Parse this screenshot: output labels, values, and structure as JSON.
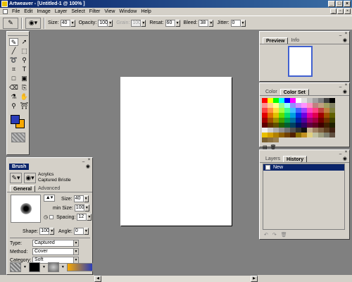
{
  "window": {
    "title": "Artweaver - [Untitled-1 @ 100% ]"
  },
  "menu": [
    "File",
    "Edit",
    "Image",
    "Layer",
    "Select",
    "Filter",
    "View",
    "Window",
    "Help"
  ],
  "options": {
    "size_label": "Size:",
    "size_value": "40",
    "opacity_label": "Opacity:",
    "opacity_value": "100",
    "grain_label": "Grain:",
    "grain_value": "100",
    "resat_label": "Resat:",
    "resat_value": "60",
    "bleed_label": "Bleed:",
    "bleed_value": "38",
    "jitter_label": "Jitter:",
    "jitter_value": "0"
  },
  "toolbox": {
    "tools": [
      "brush-icon",
      "move-arrow-icon",
      "line-icon",
      "rect-select-icon",
      "lasso-icon",
      "magic-wand-icon",
      "crop-icon",
      "text-icon",
      "rectangle-icon",
      "fill-icon",
      "eraser-icon",
      "clone-icon",
      "eyedropper-icon",
      "hand-icon",
      "zoom-icon",
      "gradient-icon"
    ],
    "foreground_color": "#2a3cb8",
    "background_color": "#f7a800"
  },
  "brush_panel": {
    "title": "Brush",
    "category_name": "Acrylics",
    "variant_name": "Captured Bristle",
    "tabs": [
      "General",
      "Advanced"
    ],
    "size_label": "Size:",
    "size_value": "40",
    "min_size_label": "min Size:",
    "min_size_value": "100",
    "spacing_label": "Spacing:",
    "spacing_value": "12",
    "shape_label": "Shape:",
    "shape_value": "100",
    "angle_label": "Angle:",
    "angle_value": "0",
    "type_label": "Type:",
    "type_value": "Captured",
    "method_label": "Method:",
    "method_value": "Cover",
    "category_label": "Category:",
    "category_value": "Soft"
  },
  "preview_panel": {
    "tabs": [
      "Preview",
      "Info"
    ]
  },
  "color_panel": {
    "tabs": [
      "Color",
      "Color Set"
    ],
    "swatches": [
      "#ff0000",
      "#ffff00",
      "#00ff00",
      "#00ffff",
      "#0000ff",
      "#ff00ff",
      "#ffffff",
      "#e0e0e0",
      "#c0c0c0",
      "#a0a0a0",
      "#808080",
      "#404040",
      "#000000",
      "#ff9090",
      "#ffd090",
      "#ffff90",
      "#90ff90",
      "#90ffff",
      "#9090ff",
      "#d090ff",
      "#ff90ff",
      "#ff90c0",
      "#c08080",
      "#c0a080",
      "#a0a060",
      "#808060",
      "#ff4040",
      "#ff9040",
      "#ffe040",
      "#a0ff40",
      "#40ff90",
      "#40c0ff",
      "#4060ff",
      "#a040ff",
      "#ff40c0",
      "#ff4080",
      "#c04040",
      "#c08040",
      "#808040",
      "#e00000",
      "#e07000",
      "#e0c000",
      "#60e000",
      "#00e070",
      "#00a0e0",
      "#0030e0",
      "#7000e0",
      "#e000a0",
      "#e00050",
      "#a00000",
      "#a05000",
      "#606000",
      "#a00000",
      "#a05000",
      "#a09000",
      "#40a000",
      "#00a050",
      "#0070a0",
      "#0020a0",
      "#5000a0",
      "#a00070",
      "#a00040",
      "#700000",
      "#703000",
      "#404000",
      "#600000",
      "#603000",
      "#605000",
      "#206000",
      "#006030",
      "#004060",
      "#001060",
      "#300060",
      "#600040",
      "#600020",
      "#400000",
      "#402000",
      "#202000",
      "#f0f0f0",
      "#d0d0d0",
      "#b0b0b0",
      "#909090",
      "#707070",
      "#505050",
      "#303030",
      "#101010",
      "#c8b090",
      "#a08060",
      "#806040",
      "#604020",
      "#402010",
      "#e8c000",
      "#d4a000",
      "#b08000",
      "#906000",
      "#704000",
      "#502000",
      "#8c7000",
      "#c09020",
      "#e0d080",
      "#c0c0a0",
      "#a0a080",
      "#808070",
      "#605040",
      "#7a6030",
      "#8a7040",
      "#9a8050"
    ]
  },
  "history_panel": {
    "tabs": [
      "Layers",
      "History"
    ],
    "items": [
      "New"
    ]
  }
}
